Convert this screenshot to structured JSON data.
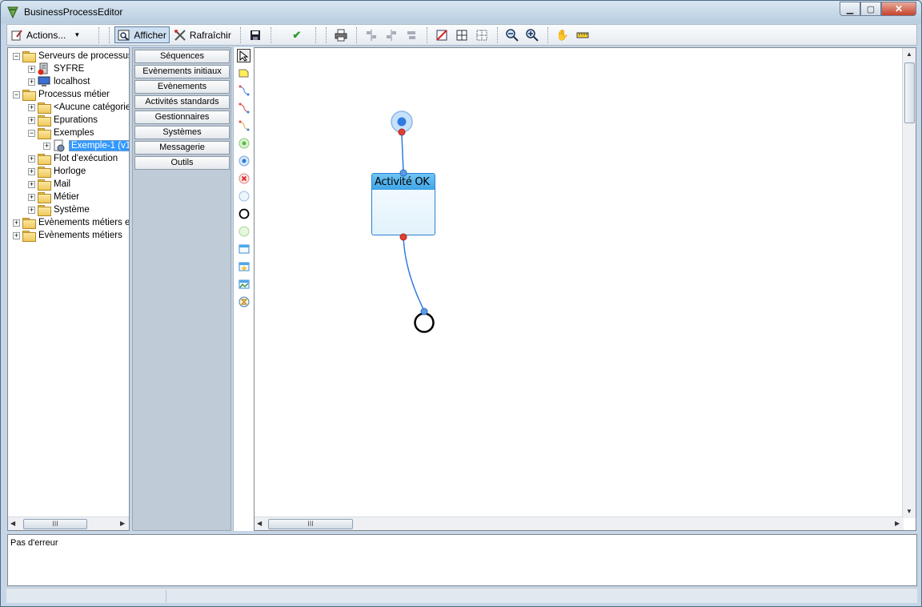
{
  "window": {
    "title": "BusinessProcessEditor"
  },
  "toolbar": {
    "actions_label": "Actions...",
    "afficher_label": "Afficher",
    "rafraichir_label": "Rafraîchir"
  },
  "tree": {
    "items": [
      {
        "label": "Serveurs de processus",
        "level": 0,
        "expander": "−",
        "icon": "folder-icon"
      },
      {
        "label": "SYFRE",
        "level": 1,
        "expander": "+",
        "icon": "server-error-icon"
      },
      {
        "label": "localhost",
        "level": 1,
        "expander": "+",
        "icon": "computer-icon"
      },
      {
        "label": "Processus métier",
        "level": 0,
        "expander": "−",
        "icon": "folder-icon"
      },
      {
        "label": "<Aucune catégorie",
        "level": 1,
        "expander": "+",
        "icon": "folder-icon"
      },
      {
        "label": "Epurations",
        "level": 1,
        "expander": "+",
        "icon": "folder-icon"
      },
      {
        "label": "Exemples",
        "level": 1,
        "expander": "−",
        "icon": "folder-icon"
      },
      {
        "label": "Exemple-1 (v1",
        "level": 2,
        "expander": "+",
        "icon": "process-icon",
        "selected": true
      },
      {
        "label": "Flot d'exécution",
        "level": 1,
        "expander": "+",
        "icon": "folder-icon"
      },
      {
        "label": "Horloge",
        "level": 1,
        "expander": "+",
        "icon": "folder-icon"
      },
      {
        "label": "Mail",
        "level": 1,
        "expander": "+",
        "icon": "folder-icon"
      },
      {
        "label": "Métier",
        "level": 1,
        "expander": "+",
        "icon": "folder-icon"
      },
      {
        "label": "Système",
        "level": 1,
        "expander": "+",
        "icon": "folder-icon"
      },
      {
        "label": "Evènements métiers en",
        "level": 0,
        "expander": "+",
        "icon": "folder-icon"
      },
      {
        "label": "Evènements métiers",
        "level": 0,
        "expander": "+",
        "icon": "folder-icon"
      }
    ]
  },
  "palette": {
    "categories": [
      "Séquences",
      "Evènements initiaux",
      "Evènements",
      "Activités standards",
      "Gestionnaires",
      "Systèmes",
      "Messagerie",
      "Outils"
    ]
  },
  "tools": [
    "pointer-icon",
    "note-icon",
    "link-blue-icon",
    "link-red-icon",
    "link-orange-icon",
    "start-green-icon",
    "start-blue-icon",
    "error-event-icon",
    "event-blue-icon",
    "end-event-icon",
    "event-green-icon",
    "activity-window-icon",
    "activity-star-icon",
    "activity-chart-icon",
    "timer-icon"
  ],
  "diagram": {
    "activity_label": "Activité OK"
  },
  "status": {
    "message": "Pas d'erreur"
  },
  "scroll_glyph": "III",
  "colors": {
    "accent": "#3fa4e6",
    "selection": "#3399ff"
  }
}
